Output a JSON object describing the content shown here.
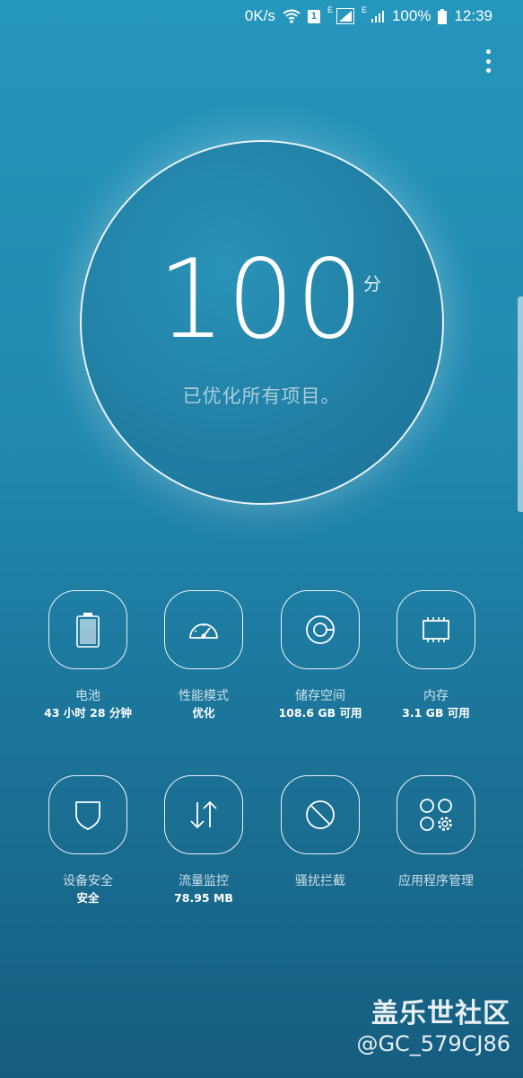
{
  "status_bar": {
    "network_speed": "0K/s",
    "sim_label": "1",
    "network_type_1": "E",
    "network_type_2": "E",
    "battery_percent": "100%",
    "time": "12:39"
  },
  "score": {
    "value": "100",
    "unit": "分",
    "subtitle": "已优化所有项目。"
  },
  "tiles": [
    {
      "label": "电池",
      "value": "43 小时 28 分钟",
      "icon": "battery-icon"
    },
    {
      "label": "性能模式",
      "value": "优化",
      "icon": "speedometer-icon"
    },
    {
      "label": "储存空间",
      "value": "108.6 GB 可用",
      "icon": "storage-disc-icon"
    },
    {
      "label": "内存",
      "value": "3.1 GB 可用",
      "icon": "memory-chip-icon"
    },
    {
      "label": "设备安全",
      "value": "安全",
      "icon": "shield-icon"
    },
    {
      "label": "流量监控",
      "value": "78.95 MB",
      "icon": "data-transfer-icon"
    },
    {
      "label": "骚扰拦截",
      "value": "",
      "icon": "block-icon"
    },
    {
      "label": "应用程序管理",
      "value": "",
      "icon": "apps-gear-icon"
    }
  ],
  "watermark": {
    "brand": "盖乐世社区",
    "user": "@GC_579CJ86"
  },
  "colors": {
    "background_top": "#2596bc",
    "background_bottom": "#155d80"
  }
}
